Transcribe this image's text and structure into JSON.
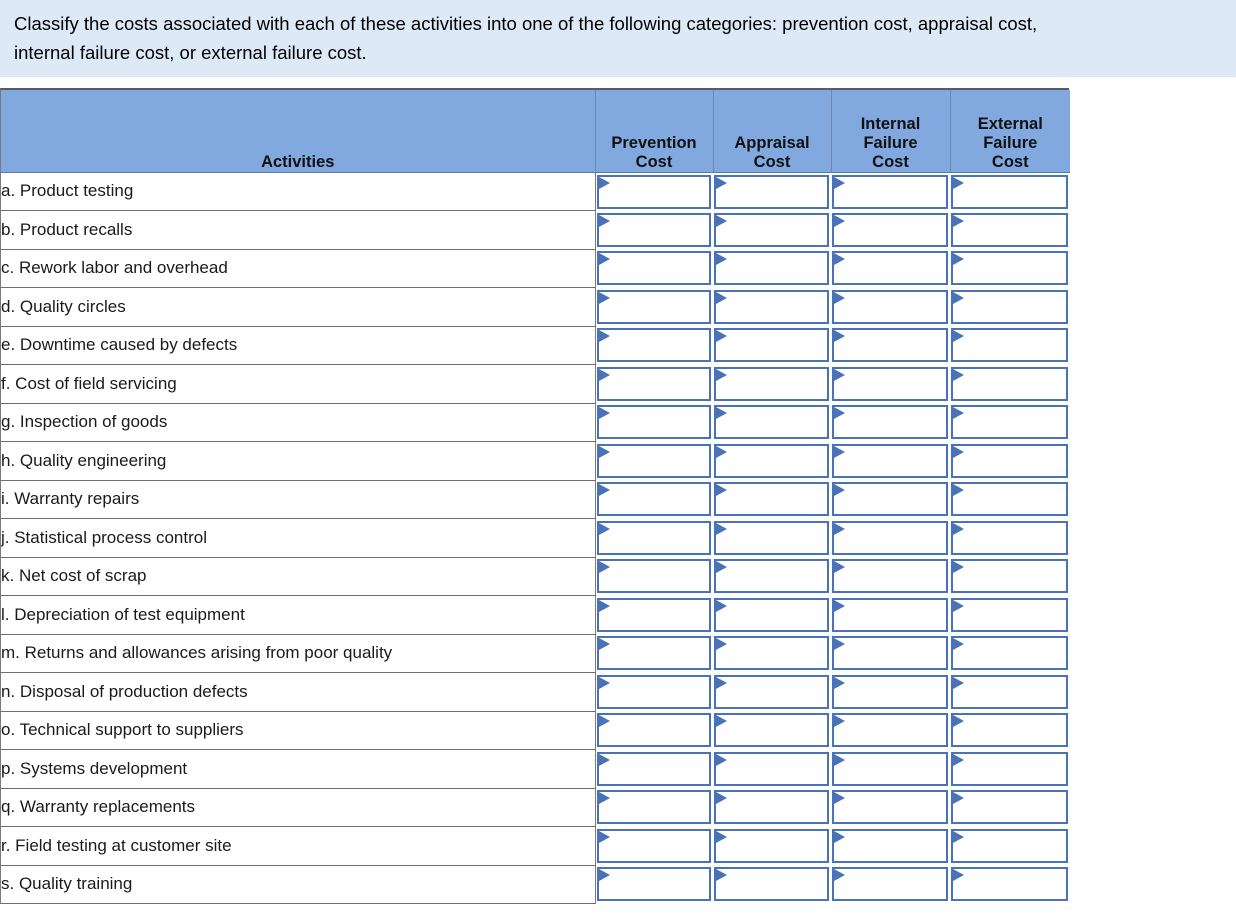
{
  "instruction": {
    "line1": "Classify the costs associated with each of these activities into one of the following categories: prevention cost, appraisal cost,",
    "line2": "internal failure cost, or external failure cost."
  },
  "table": {
    "headers": {
      "activities": "Activities",
      "prevention": "Prevention\nCost",
      "prevention_l1": "Prevention",
      "prevention_l2": "Cost",
      "appraisal_l1": "Appraisal",
      "appraisal_l2": "Cost",
      "internal_l1": "Internal",
      "internal_l2": "Failure",
      "internal_l3": "Cost",
      "external_l1": "External",
      "external_l2": "Failure",
      "external_l3": "Cost"
    },
    "rows": [
      {
        "activity": "a. Product testing",
        "prevention": "",
        "appraisal": "",
        "internal_failure": "",
        "external_failure": ""
      },
      {
        "activity": "b. Product recalls",
        "prevention": "",
        "appraisal": "",
        "internal_failure": "",
        "external_failure": ""
      },
      {
        "activity": "c. Rework labor and overhead",
        "prevention": "",
        "appraisal": "",
        "internal_failure": "",
        "external_failure": ""
      },
      {
        "activity": "d. Quality circles",
        "prevention": "",
        "appraisal": "",
        "internal_failure": "",
        "external_failure": ""
      },
      {
        "activity": "e. Downtime caused by defects",
        "prevention": "",
        "appraisal": "",
        "internal_failure": "",
        "external_failure": ""
      },
      {
        "activity": "f. Cost of field servicing",
        "prevention": "",
        "appraisal": "",
        "internal_failure": "",
        "external_failure": ""
      },
      {
        "activity": "g. Inspection of goods",
        "prevention": "",
        "appraisal": "",
        "internal_failure": "",
        "external_failure": ""
      },
      {
        "activity": "h. Quality engineering",
        "prevention": "",
        "appraisal": "",
        "internal_failure": "",
        "external_failure": ""
      },
      {
        "activity": "i. Warranty repairs",
        "prevention": "",
        "appraisal": "",
        "internal_failure": "",
        "external_failure": ""
      },
      {
        "activity": "j. Statistical process control",
        "prevention": "",
        "appraisal": "",
        "internal_failure": "",
        "external_failure": ""
      },
      {
        "activity": "k. Net cost of scrap",
        "prevention": "",
        "appraisal": "",
        "internal_failure": "",
        "external_failure": ""
      },
      {
        "activity": "l. Depreciation of test equipment",
        "prevention": "",
        "appraisal": "",
        "internal_failure": "",
        "external_failure": ""
      },
      {
        "activity": "m. Returns and allowances arising from poor quality",
        "prevention": "",
        "appraisal": "",
        "internal_failure": "",
        "external_failure": ""
      },
      {
        "activity": "n. Disposal of production defects",
        "prevention": "",
        "appraisal": "",
        "internal_failure": "",
        "external_failure": ""
      },
      {
        "activity": "o. Technical support to suppliers",
        "prevention": "",
        "appraisal": "",
        "internal_failure": "",
        "external_failure": ""
      },
      {
        "activity": "p. Systems development",
        "prevention": "",
        "appraisal": "",
        "internal_failure": "",
        "external_failure": ""
      },
      {
        "activity": "q. Warranty replacements",
        "prevention": "",
        "appraisal": "",
        "internal_failure": "",
        "external_failure": ""
      },
      {
        "activity": "r. Field testing at customer site",
        "prevention": "",
        "appraisal": "",
        "internal_failure": "",
        "external_failure": ""
      },
      {
        "activity": "s. Quality training",
        "prevention": "",
        "appraisal": "",
        "internal_failure": "",
        "external_failure": ""
      }
    ]
  },
  "colors": {
    "banner_background": "#dee9f7",
    "header_background": "#82a8e0",
    "dropdown_border": "#4a72b8",
    "row_divider": "#6e6e6e"
  }
}
